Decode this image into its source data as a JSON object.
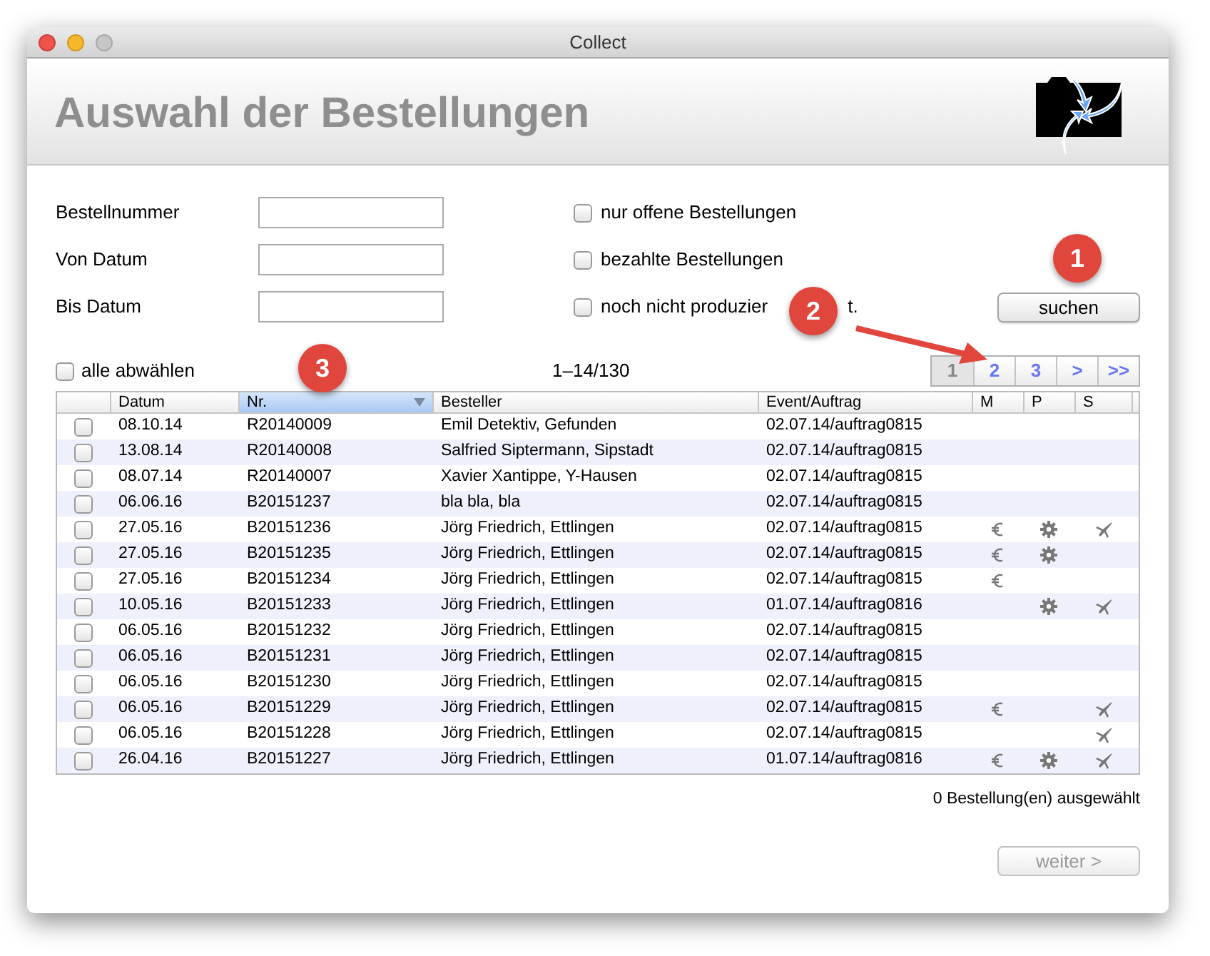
{
  "window": {
    "title": "Collect"
  },
  "header": {
    "title": "Auswahl der Bestellungen"
  },
  "form": {
    "fields": [
      {
        "label": "Bestellnummer"
      },
      {
        "label": "Von Datum"
      },
      {
        "label": "Bis Datum"
      }
    ],
    "options": [
      {
        "label_parts": [
          "nur offene Bestellungen"
        ],
        "checked": false
      },
      {
        "label_parts": [
          "bezahlte Bestellungen"
        ],
        "checked": false
      },
      {
        "label_parts": [
          "noch nicht produzier",
          "t."
        ],
        "checked": false
      }
    ],
    "search_button": "suchen"
  },
  "list_bar": {
    "select_all": {
      "label": "alle abwählen",
      "checked": false
    },
    "range": "1–14/130",
    "pages": [
      {
        "label": "1",
        "selected": true
      },
      {
        "label": "2",
        "selected": false
      },
      {
        "label": "3",
        "selected": false
      },
      {
        "label": ">",
        "selected": false
      },
      {
        "label": ">>",
        "selected": false
      }
    ]
  },
  "table": {
    "columns": [
      {
        "label": "Datum",
        "sorted": false
      },
      {
        "label": "Nr.",
        "sorted": true
      },
      {
        "label": "Besteller",
        "sorted": false
      },
      {
        "label": "Event/Auftrag",
        "sorted": false
      },
      {
        "label": "M",
        "sorted": false
      },
      {
        "label": "P",
        "sorted": false
      },
      {
        "label": "S",
        "sorted": false
      }
    ],
    "rows": [
      {
        "checked": false,
        "date": "08.10.14",
        "nr": "R20140009",
        "customer": "Emil Detektiv, Gefunden",
        "event": "02.07.14/auftrag0815",
        "m": false,
        "p": false,
        "s": false
      },
      {
        "checked": false,
        "date": "13.08.14",
        "nr": "R20140008",
        "customer": "Salfried Siptermann, Sipstadt",
        "event": "02.07.14/auftrag0815",
        "m": false,
        "p": false,
        "s": false
      },
      {
        "checked": false,
        "date": "08.07.14",
        "nr": "R20140007",
        "customer": "Xavier Xantippe, Y-Hausen",
        "event": "02.07.14/auftrag0815",
        "m": false,
        "p": false,
        "s": false
      },
      {
        "checked": false,
        "date": "06.06.16",
        "nr": "B20151237",
        "customer": "bla bla, bla",
        "event": "02.07.14/auftrag0815",
        "m": false,
        "p": false,
        "s": false
      },
      {
        "checked": false,
        "date": "27.05.16",
        "nr": "B20151236",
        "customer": "Jörg Friedrich, Ettlingen",
        "event": "02.07.14/auftrag0815",
        "m": true,
        "p": true,
        "s": true
      },
      {
        "checked": false,
        "date": "27.05.16",
        "nr": "B20151235",
        "customer": "Jörg Friedrich, Ettlingen",
        "event": "02.07.14/auftrag0815",
        "m": true,
        "p": true,
        "s": false
      },
      {
        "checked": false,
        "date": "27.05.16",
        "nr": "B20151234",
        "customer": "Jörg Friedrich, Ettlingen",
        "event": "02.07.14/auftrag0815",
        "m": true,
        "p": false,
        "s": false
      },
      {
        "checked": false,
        "date": "10.05.16",
        "nr": "B20151233",
        "customer": "Jörg Friedrich, Ettlingen",
        "event": "01.07.14/auftrag0816",
        "m": false,
        "p": true,
        "s": true
      },
      {
        "checked": false,
        "date": "06.05.16",
        "nr": "B20151232",
        "customer": "Jörg Friedrich, Ettlingen",
        "event": "02.07.14/auftrag0815",
        "m": false,
        "p": false,
        "s": false
      },
      {
        "checked": false,
        "date": "06.05.16",
        "nr": "B20151231",
        "customer": "Jörg Friedrich, Ettlingen",
        "event": "02.07.14/auftrag0815",
        "m": false,
        "p": false,
        "s": false
      },
      {
        "checked": false,
        "date": "06.05.16",
        "nr": "B20151230",
        "customer": "Jörg Friedrich, Ettlingen",
        "event": "02.07.14/auftrag0815",
        "m": false,
        "p": false,
        "s": false
      },
      {
        "checked": false,
        "date": "06.05.16",
        "nr": "B20151229",
        "customer": "Jörg Friedrich, Ettlingen",
        "event": "02.07.14/auftrag0815",
        "m": true,
        "p": false,
        "s": true
      },
      {
        "checked": false,
        "date": "06.05.16",
        "nr": "B20151228",
        "customer": "Jörg Friedrich, Ettlingen",
        "event": "02.07.14/auftrag0815",
        "m": false,
        "p": false,
        "s": true
      },
      {
        "checked": false,
        "date": "26.04.16",
        "nr": "B20151227",
        "customer": "Jörg Friedrich, Ettlingen",
        "event": "01.07.14/auftrag0816",
        "m": true,
        "p": true,
        "s": true
      }
    ]
  },
  "selection_count": "0 Bestellung(en) ausgewählt",
  "next_button": "weiter >",
  "callouts": [
    {
      "label": "1"
    },
    {
      "label": "2"
    },
    {
      "label": "3"
    }
  ]
}
